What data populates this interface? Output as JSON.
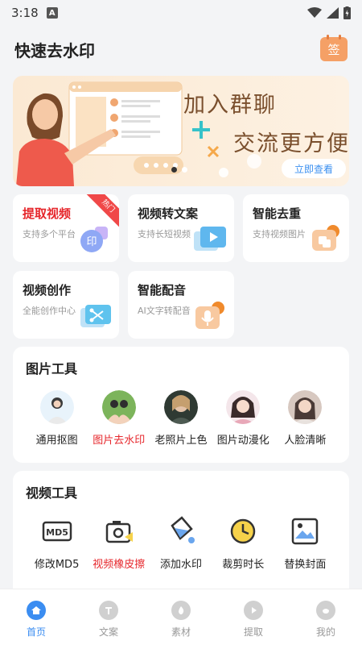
{
  "status_bar": {
    "time": "3:18",
    "notification": "A"
  },
  "header": {
    "title": "快速去水印",
    "sign_label": "签"
  },
  "banner": {
    "line1": "加入群聊",
    "line2": "交流更方便",
    "button": "立即查看"
  },
  "features": [
    {
      "title": "提取视频",
      "subtitle": "支持多个平台",
      "badge": "热门",
      "icon": "stamp-icon",
      "color": "#8fa8f5"
    },
    {
      "title": "视频转文案",
      "subtitle": "支持长短视频",
      "icon": "video-play-icon",
      "color": "#5fb7ee"
    },
    {
      "title": "智能去重",
      "subtitle": "支持视频图片",
      "icon": "dedupe-icon",
      "color": "#f59a58"
    },
    {
      "title": "视频创作",
      "subtitle": "全能创作中心",
      "icon": "scissors-icon",
      "color": "#5fc3ee"
    },
    {
      "title": "智能配音",
      "subtitle": "AI文字转配音",
      "icon": "microphone-icon",
      "color": "#f5a85a"
    }
  ],
  "image_tools": {
    "title": "图片工具",
    "items": [
      {
        "label": "通用抠图"
      },
      {
        "label": "图片去水印"
      },
      {
        "label": "老照片上色"
      },
      {
        "label": "图片动漫化"
      },
      {
        "label": "人脸清晰"
      }
    ]
  },
  "video_tools": {
    "title": "视频工具",
    "items": [
      {
        "label": "修改MD5",
        "icon": "md5-icon"
      },
      {
        "label": "视频橡皮擦",
        "icon": "camera-eraser-icon"
      },
      {
        "label": "添加水印",
        "icon": "paint-bucket-icon"
      },
      {
        "label": "裁剪时长",
        "icon": "clock-icon"
      },
      {
        "label": "替换封面",
        "icon": "image-frame-icon"
      }
    ]
  },
  "tabs": [
    {
      "label": "首页",
      "active": true,
      "icon": "home-icon"
    },
    {
      "label": "文案",
      "icon": "text-icon"
    },
    {
      "label": "素材",
      "icon": "fire-icon"
    },
    {
      "label": "提取",
      "icon": "play-icon"
    },
    {
      "label": "我的",
      "icon": "user-icon"
    }
  ],
  "colors": {
    "accent": "#3b8df1",
    "highlight_red": "#e6262b",
    "sign_orange": "#f5a066"
  }
}
